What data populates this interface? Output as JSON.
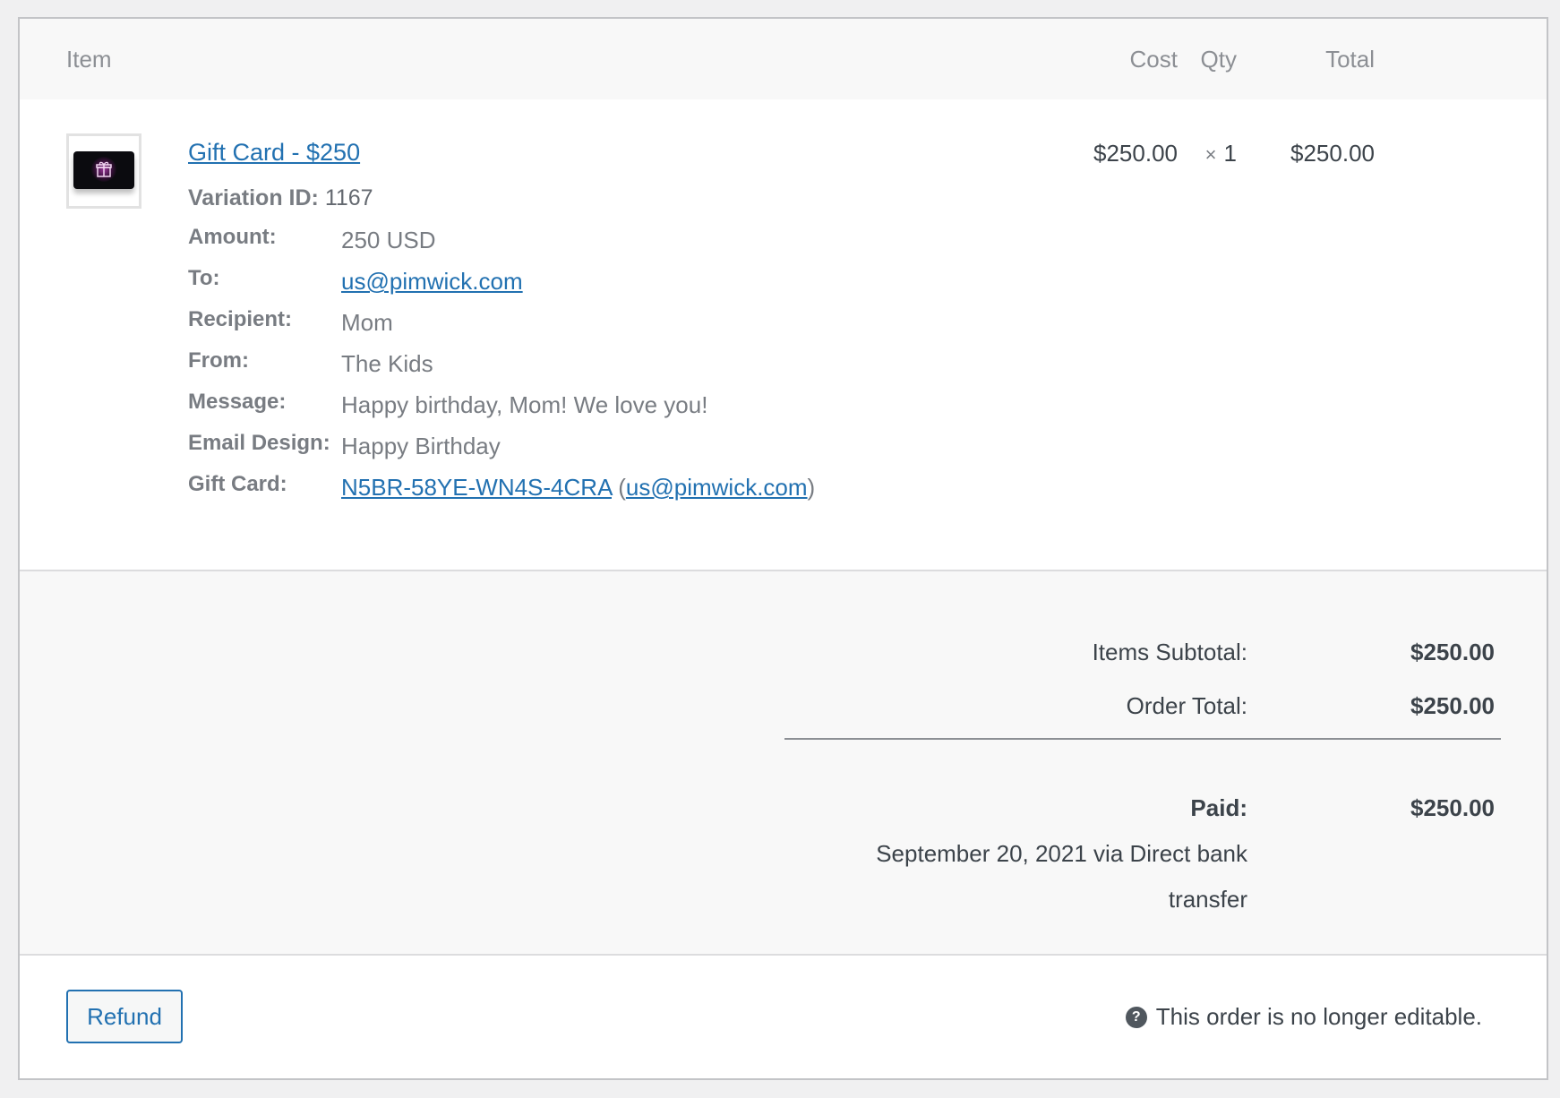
{
  "table": {
    "headers": {
      "item": "Item",
      "cost": "Cost",
      "qty": "Qty",
      "total": "Total"
    }
  },
  "line_item": {
    "thumbnail_icon": "gift-card-thumbnail",
    "name": "Gift Card - $250",
    "variation_label": "Variation ID:",
    "variation_id": "1167",
    "meta": [
      {
        "label": "Amount:",
        "value": "250 USD"
      },
      {
        "label": "To:",
        "value": "us@pimwick.com"
      },
      {
        "label": "Recipient:",
        "value": "Mom"
      },
      {
        "label": "From:",
        "value": "The Kids"
      },
      {
        "label": "Message:",
        "value": "Happy birthday, Mom! We love you!"
      },
      {
        "label": "Email Design:",
        "value": "Happy Birthday"
      },
      {
        "label": "Gift Card:",
        "code": "N5BR-58YE-WN4S-4CRA",
        "paren_open": "(",
        "email": "us@pimwick.com",
        "paren_close": ")"
      }
    ],
    "cost": "$250.00",
    "qty_symbol": "×",
    "qty": "1",
    "total": "$250.00"
  },
  "totals": {
    "items_subtotal_label": "Items Subtotal:",
    "items_subtotal_value": "$250.00",
    "order_total_label": "Order Total:",
    "order_total_value": "$250.00",
    "paid_label": "Paid:",
    "paid_value": "$250.00",
    "paid_note": "September 20, 2021 via Direct bank transfer"
  },
  "footer": {
    "refund_label": "Refund",
    "help_icon": "question-circle-icon",
    "help_glyph": "?",
    "not_editable_text": "This order is no longer editable."
  },
  "colors": {
    "link": "#2271b1",
    "border": "#c3c4c7",
    "panel_bg": "#f8f8f8"
  }
}
